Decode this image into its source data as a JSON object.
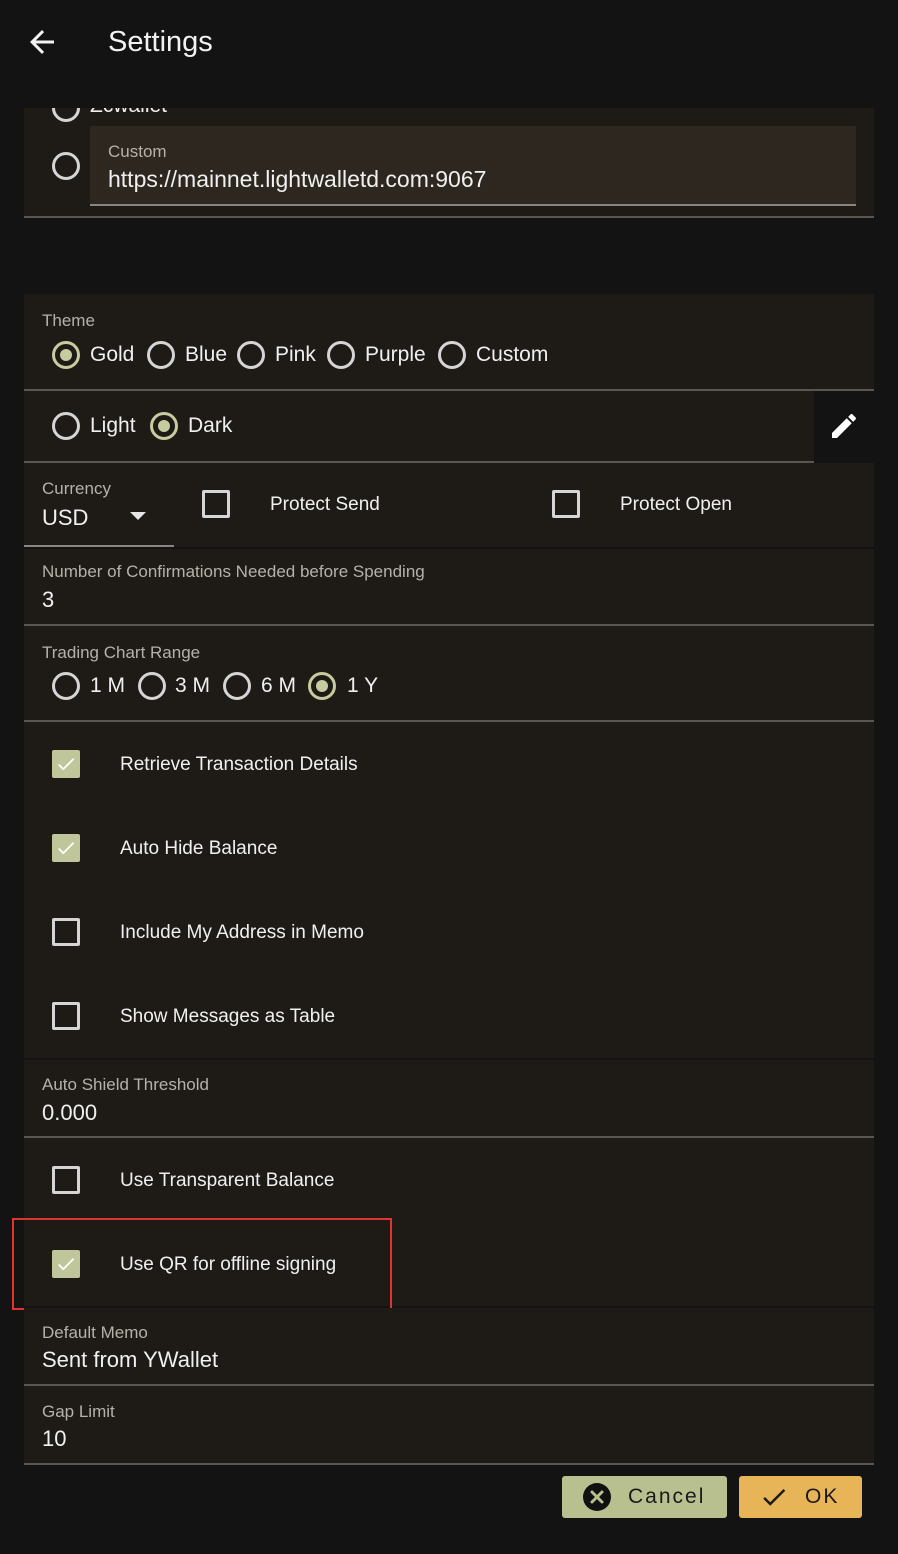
{
  "appbar": {
    "title": "Settings",
    "back_icon": "arrow-left-icon"
  },
  "server": {
    "partial_option_label": "Zcwallet",
    "custom_label": "Custom",
    "custom_value": "https://mainnet.lightwalletd.com:9067"
  },
  "theme": {
    "label": "Theme",
    "options": [
      "Gold",
      "Blue",
      "Pink",
      "Purple",
      "Custom"
    ],
    "selected": "Gold",
    "brightness_options": [
      "Light",
      "Dark"
    ],
    "brightness_selected": "Dark",
    "edit_icon": "pencil-icon"
  },
  "currency": {
    "label": "Currency",
    "value": "USD"
  },
  "protect": {
    "send_label": "Protect Send",
    "open_label": "Protect Open",
    "send_checked": false,
    "open_checked": false
  },
  "confirmations": {
    "label": "Number of Confirmations Needed before Spending",
    "value": "3"
  },
  "chart_range": {
    "label": "Trading Chart Range",
    "options": [
      "1 M",
      "3 M",
      "6 M",
      "1 Y"
    ],
    "selected": "1 Y"
  },
  "toggles": [
    {
      "label": "Retrieve Transaction Details",
      "checked": true
    },
    {
      "label": "Auto Hide Balance",
      "checked": true
    },
    {
      "label": "Include My Address in Memo",
      "checked": false
    },
    {
      "label": "Show Messages as Table",
      "checked": false
    }
  ],
  "auto_shield": {
    "label": "Auto Shield Threshold",
    "value": "0.000"
  },
  "toggles2": [
    {
      "label": "Use Transparent Balance",
      "checked": false
    },
    {
      "label": "Use QR for offline signing",
      "checked": true
    }
  ],
  "default_memo": {
    "label": "Default Memo",
    "value": "Sent from YWallet"
  },
  "gap_limit": {
    "label": "Gap Limit",
    "value": "10"
  },
  "actions": {
    "cancel_label": "Cancel",
    "ok_label": "OK"
  },
  "colors": {
    "accent": "#c6cba0",
    "cancel_bg": "#b9c08f",
    "ok_bg": "#e8b458",
    "highlight": "#e0352e"
  }
}
